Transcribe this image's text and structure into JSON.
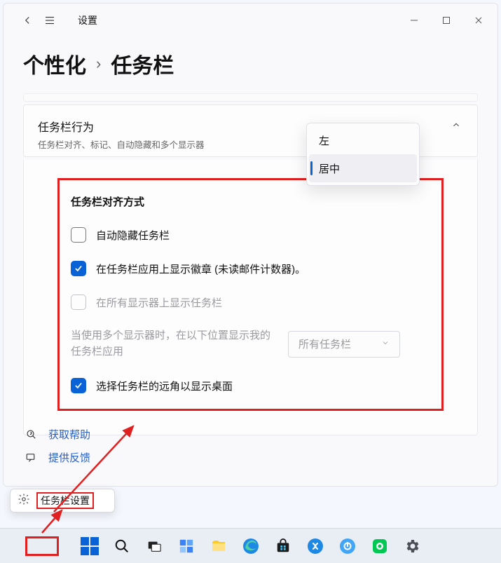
{
  "window": {
    "app_title": "设置",
    "breadcrumb_parent": "个性化",
    "breadcrumb_sep": "›",
    "breadcrumb_current": "任务栏"
  },
  "section": {
    "behave_title": "任务栏行为",
    "behave_subtitle": "任务栏对齐、标记、自动隐藏和多个显示器"
  },
  "items": {
    "alignment_label": "任务栏对齐方式",
    "auto_hide_label": "自动隐藏任务栏",
    "badges_label": "在任务栏应用上显示徽章 (未读邮件计数器)。",
    "all_displays_label": "在所有显示器上显示任务栏",
    "multi_desc": "当使用多个显示器时，在以下位置显示我的任务栏应用",
    "select_value": "所有任务栏",
    "show_desktop_label": "选择任务栏的远角以显示桌面"
  },
  "dropdown": {
    "opt_left": "左",
    "opt_center": "居中"
  },
  "help": {
    "get_help": "获取帮助",
    "feedback": "提供反馈"
  },
  "context_menu": {
    "taskbar_settings": "任务栏设置"
  }
}
